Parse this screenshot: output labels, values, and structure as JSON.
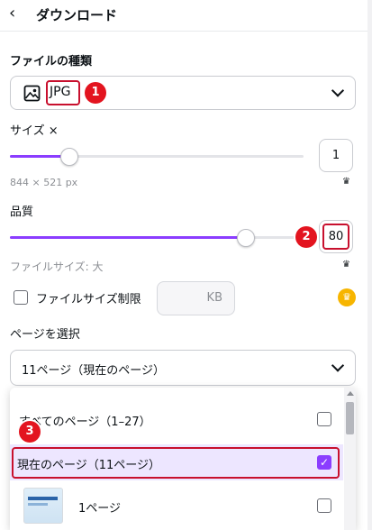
{
  "header": {
    "title": "ダウンロード"
  },
  "file_type": {
    "label": "ファイルの種類",
    "selected": "JPG",
    "badge": "1"
  },
  "size": {
    "label": "サイズ ×",
    "value": "1",
    "level": 0.2,
    "dimensions": "844 × 521 px"
  },
  "quality": {
    "label": "品質",
    "value": "80",
    "level": 0.8,
    "badge": "2",
    "file_size_label": "ファイルサイズ: 大"
  },
  "file_size_limit": {
    "label": "ファイルサイズ制限",
    "unit": "KB",
    "checked": false
  },
  "page_select": {
    "label": "ページを選択",
    "selected": "11ページ（現在のページ）",
    "badge": "3",
    "options": [
      {
        "label": "すべてのページ（1–27）",
        "checked": false
      },
      {
        "label": "現在のページ（11ページ）",
        "checked": true
      },
      {
        "label": "1ページ",
        "checked": false
      }
    ]
  },
  "colors": {
    "accent": "#8b3dff",
    "annotation": "#e3141f"
  }
}
